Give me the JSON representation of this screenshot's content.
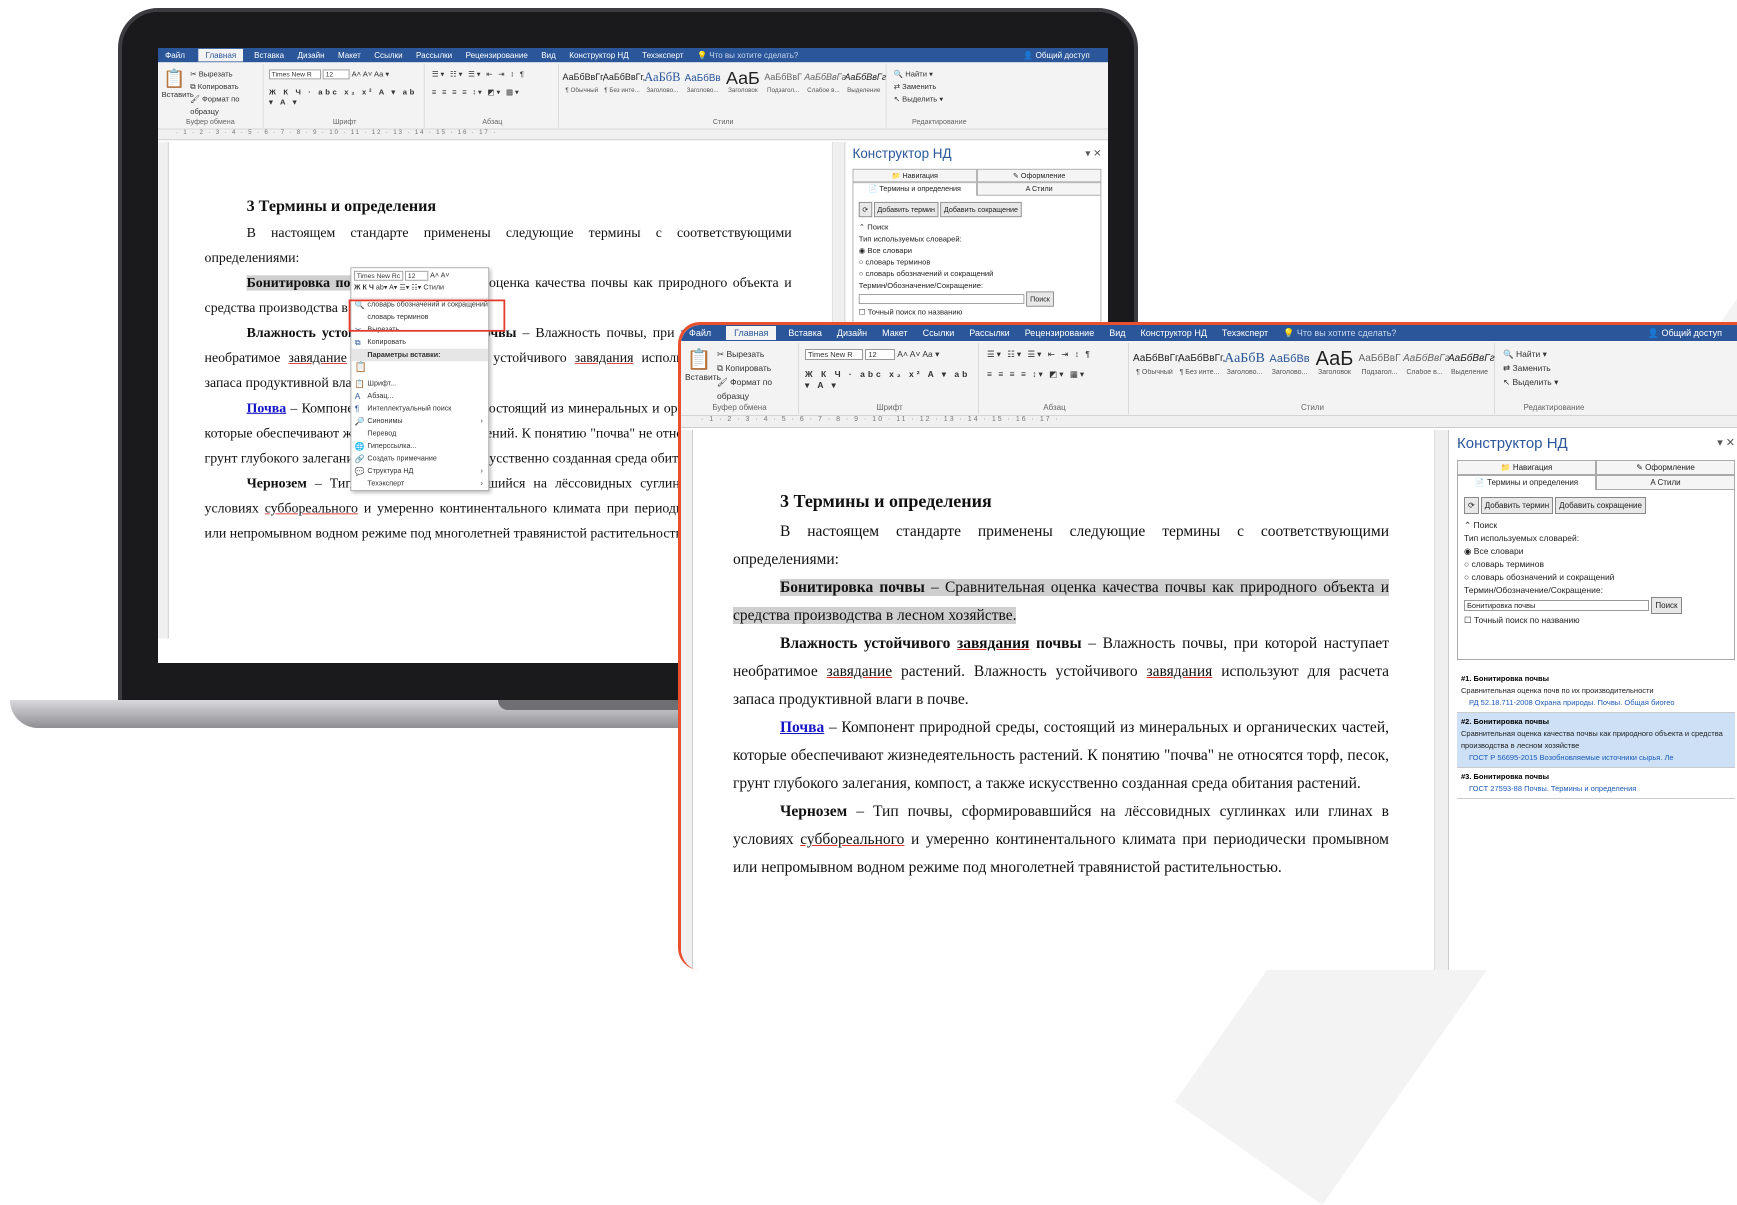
{
  "title_tabs": [
    "Файл",
    "Главная",
    "Вставка",
    "Дизайн",
    "Макет",
    "Ссылки",
    "Рассылки",
    "Рецензирование",
    "Вид",
    "Конструктор НД",
    "Техэксперт"
  ],
  "active_tab": "Главная",
  "tell_me": "Что вы хотите сделать?",
  "share": "Общий доступ",
  "ribbon": {
    "clipboard": {
      "paste": "Вставить",
      "cut": "Вырезать",
      "copy": "Копировать",
      "format": "Формат по образцу",
      "label": "Буфер обмена"
    },
    "font": {
      "name": "Times New R",
      "size": "12",
      "label": "Шрифт"
    },
    "paragraph": {
      "label": "Абзац"
    },
    "styles": {
      "label": "Стили",
      "items": [
        {
          "sample": "АаБбВвГг,",
          "name": "¶ Обычный"
        },
        {
          "sample": "АаБбВвГг,",
          "name": "¶ Без инте..."
        },
        {
          "sample": "АаБбВ",
          "name": "Заголово..."
        },
        {
          "sample": "АаБбВв",
          "name": "Заголово..."
        },
        {
          "sample": "АаБ",
          "name": "Заголовок"
        },
        {
          "sample": "АаБбВвГ",
          "name": "Подзагол..."
        },
        {
          "sample": "АаБбВвГг",
          "name": "Слабое в..."
        },
        {
          "sample": "АаБбВвГг",
          "name": "Выделение"
        }
      ]
    },
    "editing": {
      "find": "Найти",
      "replace": "Заменить",
      "select": "Выделить",
      "label": "Редактирование"
    }
  },
  "document": {
    "heading": "3 Термины и определения",
    "intro": "В настоящем стандарте применены следующие термины с соответствующими определениями:",
    "t1_term": "Бонитировка почвы",
    "t1_def": " – Сравнительная оценка качества почвы как природного объекта и средства производства в лесном хозяйстве.",
    "t2_a": "Влажность устойчивого ",
    "t2_b": "завядания",
    "t2_c": " почвы",
    "t2_def_1": " – Влажность почвы, при которой наступает необратимое ",
    "t2_def_2": "завядание",
    "t2_def_3": " растений. Влажность устойчивого ",
    "t2_def_4": "завядания",
    "t2_def_5": " используют для расчета запаса продуктивной влаги в почве.",
    "t3_term": "Почва",
    "t3_def": " – Компонент природной среды, состоящий из минеральных и органических частей, которые обеспечивают жизнедеятельность растений. К понятию \"почва\" не относятся торф, песок, грунт глубокого залегания, компост, а также искусственно созданная среда обитания растений.",
    "t4_term": "Чернозем",
    "t4_def_1": " – Тип почвы, сформировавшийся на лёссовидных суглинках или глинах в условиях ",
    "t4_def_2": "суббореального",
    "t4_def_3": " и умеренно континентального климата при периодически промывном или непромывном водном режиме под многолетней травянистой растительностью."
  },
  "pane": {
    "title": "Конструктор НД",
    "tab_nav": "Навигация",
    "tab_design": "Оформление",
    "tab_terms": "Термины и определения",
    "tab_styles": "Стили",
    "add_term": "Добавить термин",
    "add_abbr": "Добавить сокращение",
    "search": "Поиск",
    "dict_type": "Тип используемых словарей:",
    "opt_all": "Все словари",
    "opt_terms": "словарь терминов",
    "opt_abbr": "словарь обозначений и сокращений",
    "field_label": "Термин/Обозначение/Сокращение:",
    "field_value": "Бонитировка почвы",
    "search_btn": "Поиск",
    "exact": "Точный поиск по названию",
    "results": [
      {
        "title": "#1.  Бонитировка почвы",
        "text": "Сравнительная оценка почв по их производительности",
        "source": "РД 52.18.711-2008 Охрана природы. Почвы. Общая биогео"
      },
      {
        "title": "#2.  Бонитировка почвы",
        "text": "Сравнительная оценка качества почвы как природного объекта и средства производства в лесном хозяйстве",
        "source": "ГОСТ Р 56695-2015 Возобновляемые источники сырья. Ле"
      },
      {
        "title": "#3.  Бонитировка почвы",
        "text": "",
        "source": "ГОСТ 27593-88 Почвы. Термины и определения"
      }
    ]
  },
  "context_menu": {
    "font": "Times New Rc",
    "size": "12",
    "styles": "Стили",
    "items": [
      "словарь обозначений и сокращений",
      "словарь терминов",
      "Вырезать",
      "Копировать",
      "Параметры вставки:",
      "Шрифт...",
      "Абзац...",
      "Интеллектуальный поиск",
      "Синонимы",
      "Перевод",
      "Гиперссылка...",
      "Создать примечание",
      "Структура НД",
      "Техэксперт"
    ]
  },
  "colors": {
    "accent": "#2b579a",
    "highlight_border": "#e8502f",
    "link": "#1515c8"
  }
}
